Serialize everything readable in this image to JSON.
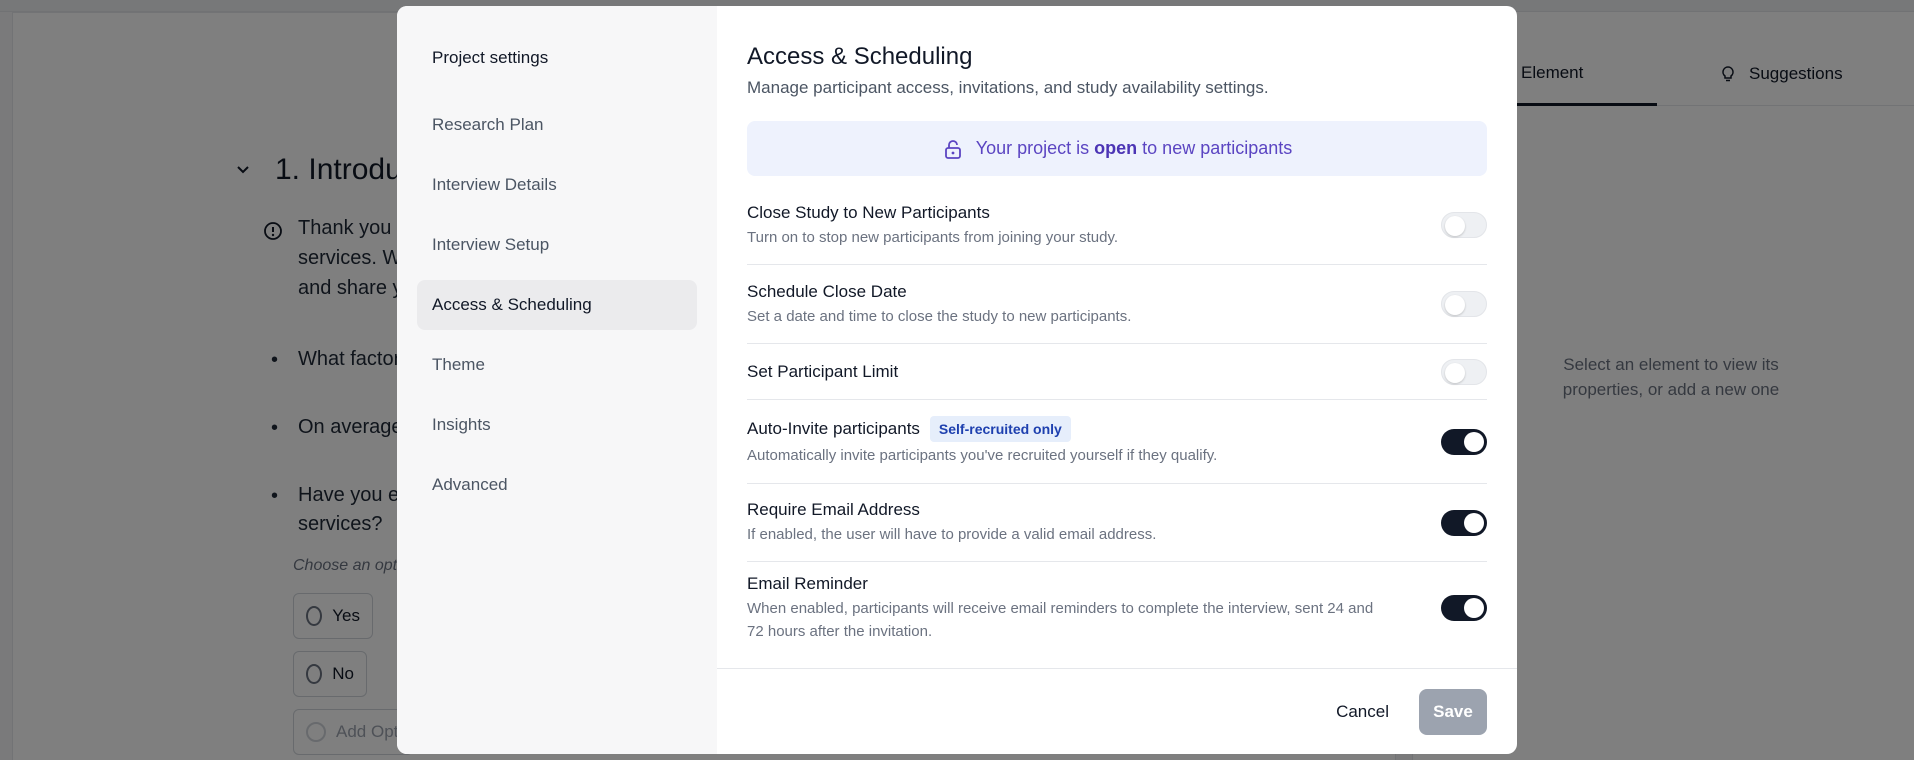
{
  "background": {
    "section_heading": "1. Introduc",
    "intro_lines": [
      "Thank you f",
      "services. W",
      "and share y"
    ],
    "bullets": [
      "What factor",
      "On average",
      "Have you e"
    ],
    "bullet_continuation": "services?",
    "choose_hint": "Choose an opt",
    "options": [
      "Yes",
      "No",
      "Add Opt"
    ],
    "right_panel": {
      "tab_element": "Element",
      "tab_suggestions": "Suggestions",
      "empty_message": "Select an element to view its properties, or add a new one"
    }
  },
  "modal": {
    "nav": {
      "title": "Project settings",
      "items": [
        {
          "label": "Research Plan",
          "active": false
        },
        {
          "label": "Interview Details",
          "active": false
        },
        {
          "label": "Interview Setup",
          "active": false
        },
        {
          "label": "Access & Scheduling",
          "active": true
        },
        {
          "label": "Theme",
          "active": false
        },
        {
          "label": "Insights",
          "active": false
        },
        {
          "label": "Advanced",
          "active": false
        }
      ]
    },
    "main": {
      "title": "Access & Scheduling",
      "subtitle": "Manage participant access, invitations, and study availability settings.",
      "banner": {
        "prefix": "Your project is",
        "status": "open",
        "suffix": "to new participants",
        "icon": "unlock-icon"
      },
      "settings": [
        {
          "title": "Close Study to New Participants",
          "desc": "Turn on to stop new participants from joining your study.",
          "enabled": false,
          "badge": ""
        },
        {
          "title": "Schedule Close Date",
          "desc": "Set a date and time to close the study to new participants.",
          "enabled": false,
          "badge": ""
        },
        {
          "title": "Set Participant Limit",
          "desc": "",
          "enabled": false,
          "badge": ""
        },
        {
          "title": "Auto-Invite participants",
          "desc": "Automatically invite participants you've recruited yourself if they qualify.",
          "enabled": true,
          "badge": "Self-recruited only"
        },
        {
          "title": "Require Email Address",
          "desc": "If enabled, the user will have to provide a valid email address.",
          "enabled": true,
          "badge": ""
        },
        {
          "title": "Email Reminder",
          "desc": "When enabled, participants will receive email reminders to complete the interview, sent 24 and 72 hours after the invitation.",
          "enabled": true,
          "badge": ""
        }
      ]
    },
    "footer": {
      "cancel_label": "Cancel",
      "save_label": "Save"
    }
  },
  "colors": {
    "banner_text": "#5b45c2",
    "toggle_on": "#111827",
    "save_disabled": "#9ca3af"
  }
}
